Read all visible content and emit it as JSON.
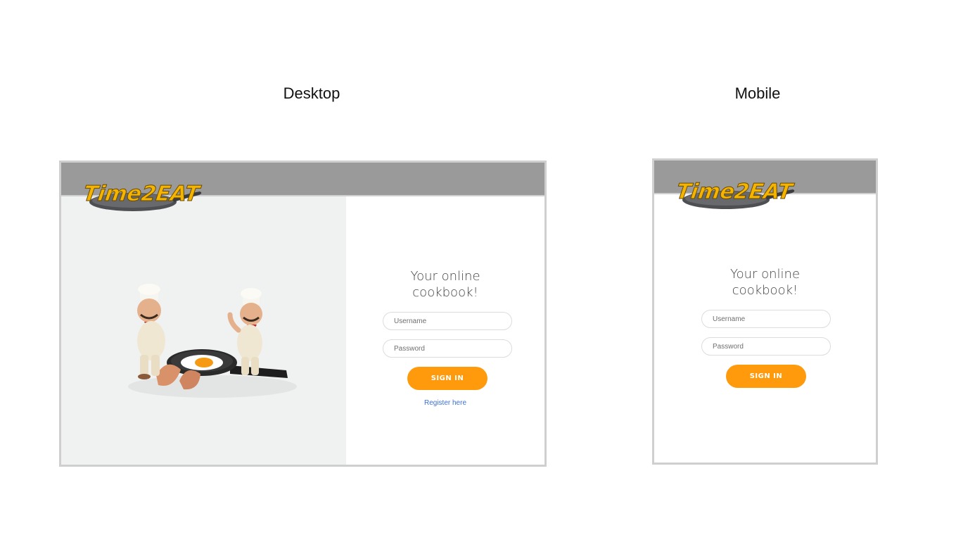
{
  "captions": {
    "desktop": "Desktop",
    "mobile": "Mobile"
  },
  "brand": {
    "logo_text": "Time2EAT"
  },
  "login": {
    "tagline_line1": "Your online",
    "tagline_line2": "cookbook!",
    "username_placeholder": "Username",
    "password_placeholder": "Password",
    "signin_label": "SIGN IN",
    "register_link": "Register here"
  },
  "colors": {
    "topbar": "#9a9a9a",
    "accent": "#ff9a0c",
    "logo_yellow": "#f4b400",
    "link": "#3b6fd6"
  }
}
